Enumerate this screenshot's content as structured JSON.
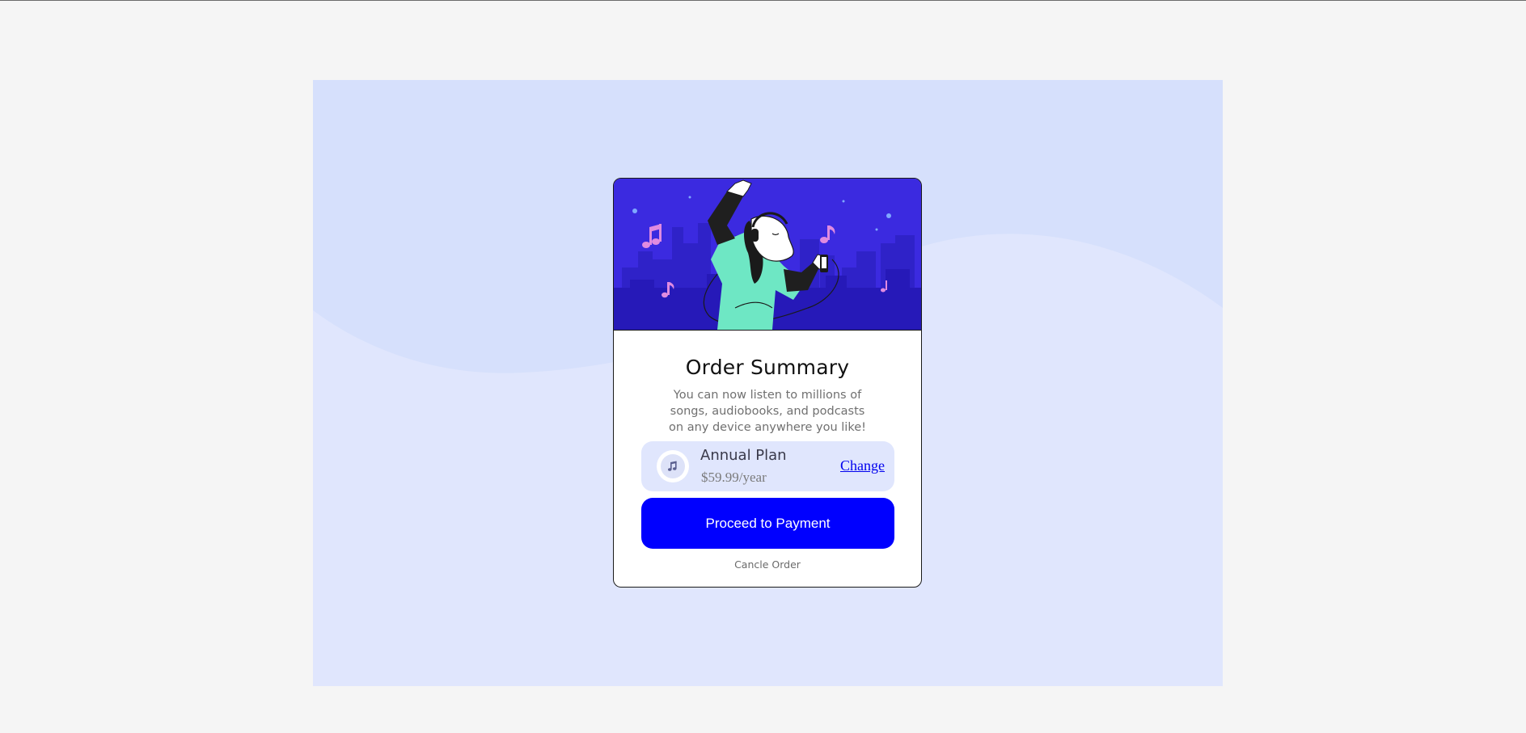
{
  "order": {
    "title": "Order Summary",
    "description": "You can now listen to millions of songs, audiobooks, and podcasts on any device anywhere you like!",
    "plan": {
      "name": "Annual Plan",
      "price": "$59.99/year",
      "change_label": "Change",
      "icon": "music-note-icon"
    },
    "proceed_label": "Proceed to Payment",
    "cancel_label": "Cancle Order"
  },
  "colors": {
    "page_background": "#f5f5f5",
    "stage_background": "#e0e6fd",
    "hero_background": "#3b2ae0",
    "plan_background": "#e0e6fd",
    "primary_button": "#0000ff",
    "link": "#0000ee"
  }
}
